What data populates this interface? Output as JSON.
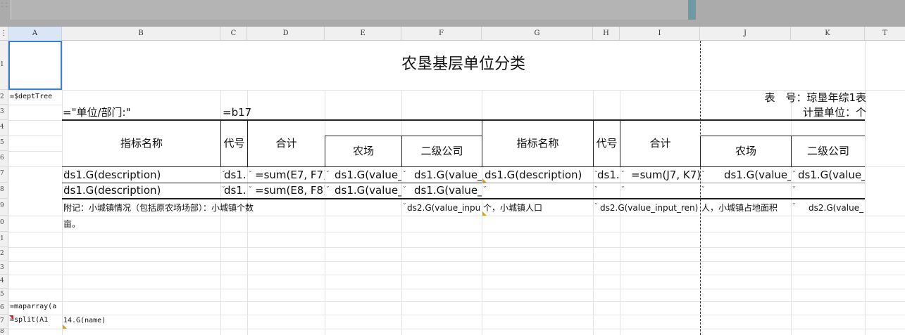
{
  "toolbar": {
    "grip_icon": "vertical-dots"
  },
  "columns": [
    "A",
    "B",
    "C",
    "D",
    "E",
    "F",
    "G",
    "H",
    "I",
    "J",
    "K",
    "T"
  ],
  "rows": [
    "1",
    "2",
    "3",
    "4",
    "5",
    "6",
    "7",
    "8",
    "9",
    "0",
    "1",
    "2",
    "3",
    "4",
    "5",
    "6",
    "7",
    "8"
  ],
  "sheet": {
    "title": "农垦基层单位分类",
    "a2": "=$deptTree",
    "form_no": "表　号：琼垦年综1表",
    "b3": "=\"单位/部门:\"",
    "c3": "=b17",
    "unit": "计量单位：个",
    "header_left": {
      "name": "指标名称",
      "code": "代号",
      "total": "合计",
      "farm": "农场",
      "company": "二级公司"
    },
    "header_right": {
      "name": "指标名称",
      "code": "代号",
      "total": "合计",
      "farm": "农场",
      "company": "二级公司"
    },
    "row7": {
      "b": "ds1.G(description)",
      "c": "ds1.",
      "d": "=sum(E7, F7)",
      "e": "ds1.G(value_",
      "f": "ds1.G(value_",
      "g": "ds1.G(description)",
      "h": "ds1.",
      "i": "=sum(J7, K7)",
      "j": "ds1.G(value_",
      "k": "ds1.G(value_"
    },
    "row8": {
      "b": "ds1.G(description)",
      "c": "ds1.",
      "d": "=sum(E8, F8)",
      "e": "ds1.G(value_",
      "f": "ds1.G(value_"
    },
    "row9": {
      "b": "附记：小城镇情况（包括原农场场部）：小城镇个数",
      "f": "ds2.G(value_inpu",
      "g": "个，小城镇人口",
      "i": "ds2.G(value_input_ren)",
      "j": "人，小城镇占地面积",
      "k": "ds2.G(value_"
    },
    "row10": {
      "b": "亩。"
    },
    "a16": "=maparray(a",
    "a17": "=split(A1",
    "b17": "14.G(name)"
  }
}
